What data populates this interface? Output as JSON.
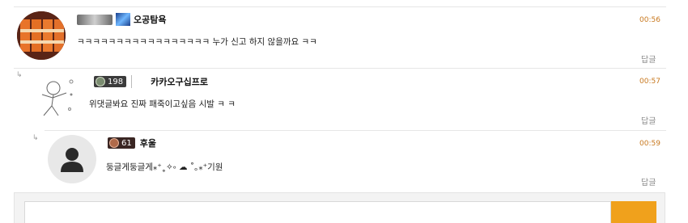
{
  "comments": [
    {
      "nickname": "오공탐욕",
      "time": "00:56",
      "text": "ㅋㅋㅋㅋㅋㅋㅋㅋㅋㅋㅋㅋㅋㅋㅋㅋㅋ 누가 신고 하지 않을까요 ㅋㅋ",
      "reply_label": "답글"
    },
    {
      "nickname": "카카오구십프로",
      "level": "198",
      "time": "00:57",
      "text": "위댓글봐요 진짜 패죽이고싶음 시발 ㅋ ㅋ",
      "reply_label": "답글",
      "reply_arrow": "↳"
    },
    {
      "nickname": "후울",
      "level": "61",
      "time": "00:59",
      "text": "둥글게둥글게⁎⁺˳✧༚ ☁ ˚｡⁎⁺기원",
      "reply_label": "답글",
      "reply_arrow": "↳"
    }
  ],
  "colors": {
    "accent": "#f0a11c",
    "time": "#c8781e"
  }
}
